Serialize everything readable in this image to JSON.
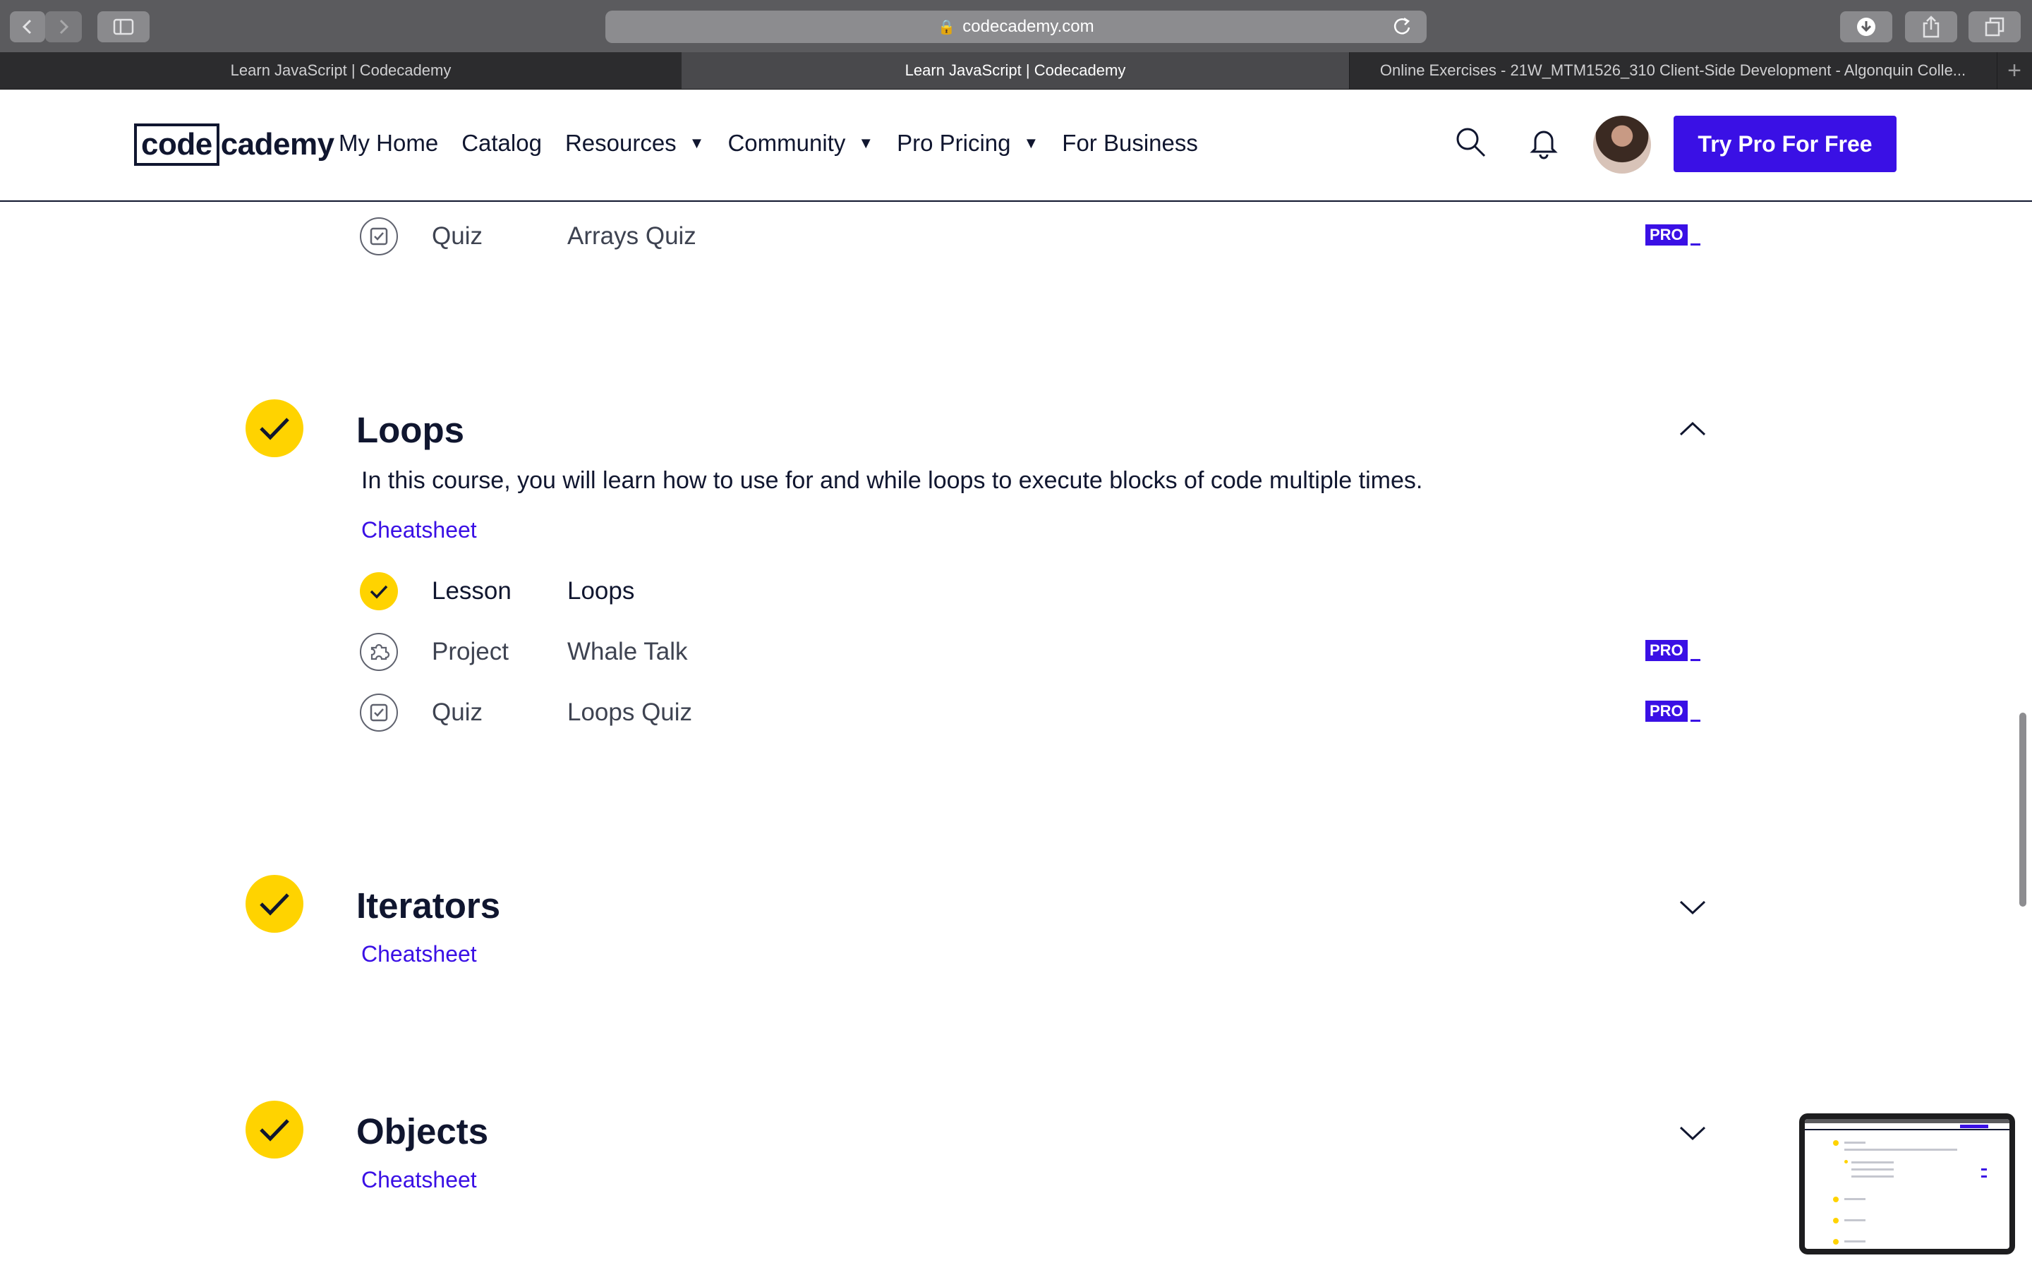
{
  "browser": {
    "url": "codecademy.com",
    "tabs": [
      {
        "label": "Learn JavaScript | Codecademy",
        "active": false
      },
      {
        "label": "Learn JavaScript | Codecademy",
        "active": true
      },
      {
        "label": "Online Exercises - 21W_MTM1526_310 Client-Side Development - Algonquin Colle...",
        "active": false
      }
    ],
    "new_tab": "+"
  },
  "header": {
    "logo_code": "code",
    "logo_rest": "cademy",
    "nav": [
      {
        "label": "My Home",
        "dropdown": false
      },
      {
        "label": "Catalog",
        "dropdown": false
      },
      {
        "label": "Resources",
        "dropdown": true
      },
      {
        "label": "Community",
        "dropdown": true
      },
      {
        "label": "Pro Pricing",
        "dropdown": true
      },
      {
        "label": "For Business",
        "dropdown": false
      }
    ],
    "cta": "Try Pro For Free"
  },
  "pro_badge": "PRO",
  "arrays_tail": {
    "row": {
      "type": "Quiz",
      "title": "Arrays Quiz",
      "pro": true,
      "icon": "quiz-icon"
    }
  },
  "loops": {
    "title": "Loops",
    "description": "In this course, you will learn how to use for and while loops to execute blocks of code multiple times.",
    "cheatsheet": "Cheatsheet",
    "expanded": true,
    "rows": [
      {
        "type": "Lesson",
        "title": "Loops",
        "completed": true,
        "pro": false,
        "icon": "check-icon"
      },
      {
        "type": "Project",
        "title": "Whale Talk",
        "completed": false,
        "pro": true,
        "icon": "puzzle-icon"
      },
      {
        "type": "Quiz",
        "title": "Loops Quiz",
        "completed": false,
        "pro": true,
        "icon": "quiz-icon"
      }
    ]
  },
  "iterators": {
    "title": "Iterators",
    "cheatsheet": "Cheatsheet",
    "expanded": false
  },
  "objects": {
    "title": "Objects",
    "cheatsheet": "Cheatsheet",
    "expanded": false
  },
  "colors": {
    "accent": "#3a10e5",
    "complete": "#ffd300",
    "text": "#10162f"
  }
}
